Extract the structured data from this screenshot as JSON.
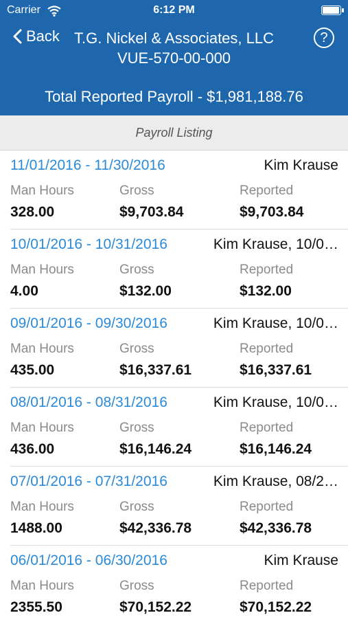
{
  "status_bar": {
    "carrier": "Carrier",
    "time": "6:12 PM",
    "battery_level": 1.0
  },
  "header": {
    "back_label": "Back",
    "help_label": "?",
    "company": "T.G. Nickel & Associates, LLC",
    "account": "VUE-570-00-000",
    "total": "Total Reported Payroll - $1,981,188.76"
  },
  "section_title": "Payroll Listing",
  "column_labels": {
    "man_hours": "Man Hours",
    "gross": "Gross",
    "reported": "Reported"
  },
  "entries": [
    {
      "period": "11/01/2016 - 11/30/2016",
      "submitter": "Kim  Krause",
      "man_hours": "328.00",
      "gross": "$9,703.84",
      "reported": "$9,703.84"
    },
    {
      "period": "10/01/2016 - 10/31/2016",
      "submitter": "Kim Krause, 10/0…",
      "man_hours": "4.00",
      "gross": "$132.00",
      "reported": "$132.00"
    },
    {
      "period": "09/01/2016 - 09/30/2016",
      "submitter": "Kim Krause, 10/0…",
      "man_hours": "435.00",
      "gross": "$16,337.61",
      "reported": "$16,337.61"
    },
    {
      "period": "08/01/2016 - 08/31/2016",
      "submitter": "Kim Krause, 10/0…",
      "man_hours": "436.00",
      "gross": "$16,146.24",
      "reported": "$16,146.24"
    },
    {
      "period": "07/01/2016 - 07/31/2016",
      "submitter": "Kim  Krause, 08/2…",
      "man_hours": "1488.00",
      "gross": "$42,336.78",
      "reported": "$42,336.78"
    },
    {
      "period": "06/01/2016 - 06/30/2016",
      "submitter": "Kim  Krause",
      "man_hours": "2355.50",
      "gross": "$70,152.22",
      "reported": "$70,152.22"
    }
  ],
  "colors": {
    "header_bg": "#1f67ad",
    "period_text": "#2a8ad8",
    "section_bg": "#ececec"
  }
}
